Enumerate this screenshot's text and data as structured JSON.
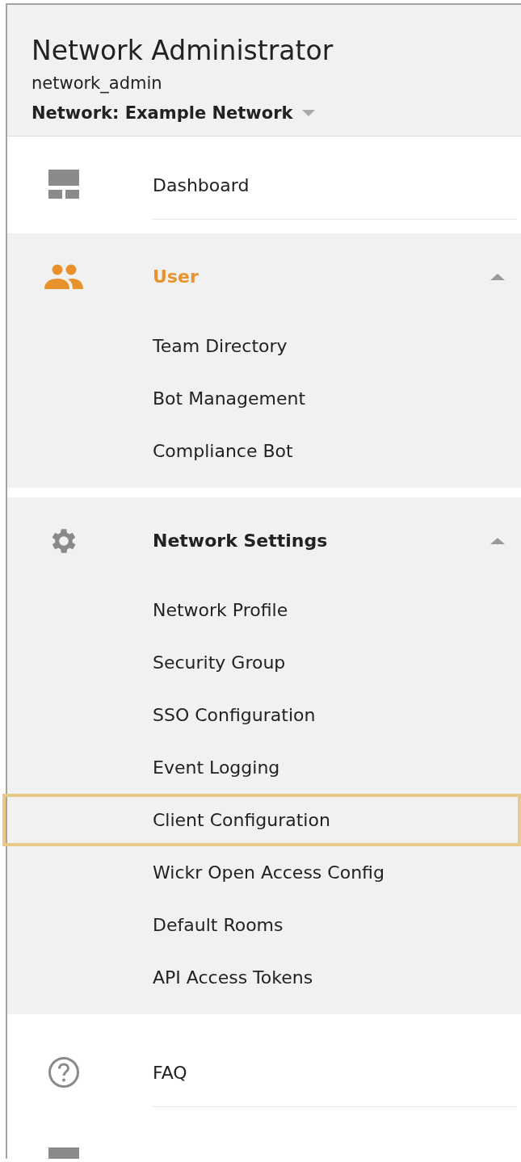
{
  "header": {
    "title": "Network Administrator",
    "username": "network_admin",
    "network_selector": {
      "label": "Network: Example Network"
    }
  },
  "nav": [
    {
      "kind": "link",
      "label": "Dashboard"
    },
    {
      "kind": "group",
      "label": "User",
      "selected": true,
      "expanded": true,
      "children": [
        {
          "label": "Team Directory",
          "highlighted": false
        },
        {
          "label": "Bot Management",
          "highlighted": false
        },
        {
          "label": "Compliance Bot",
          "highlighted": false
        }
      ]
    },
    {
      "kind": "group",
      "label": "Network Settings",
      "selected": false,
      "expanded": true,
      "children": [
        {
          "label": "Network Profile",
          "highlighted": false
        },
        {
          "label": "Security Group",
          "highlighted": false
        },
        {
          "label": "SSO Configuration",
          "highlighted": false
        },
        {
          "label": "Event Logging",
          "highlighted": false
        },
        {
          "label": "Client Configuration",
          "highlighted": true
        },
        {
          "label": "Wickr Open Access Config",
          "highlighted": false
        },
        {
          "label": "Default Rooms",
          "highlighted": false
        },
        {
          "label": "API Access Tokens",
          "highlighted": false
        }
      ]
    },
    {
      "kind": "link",
      "label": "FAQ"
    },
    {
      "kind": "cut"
    }
  ]
}
